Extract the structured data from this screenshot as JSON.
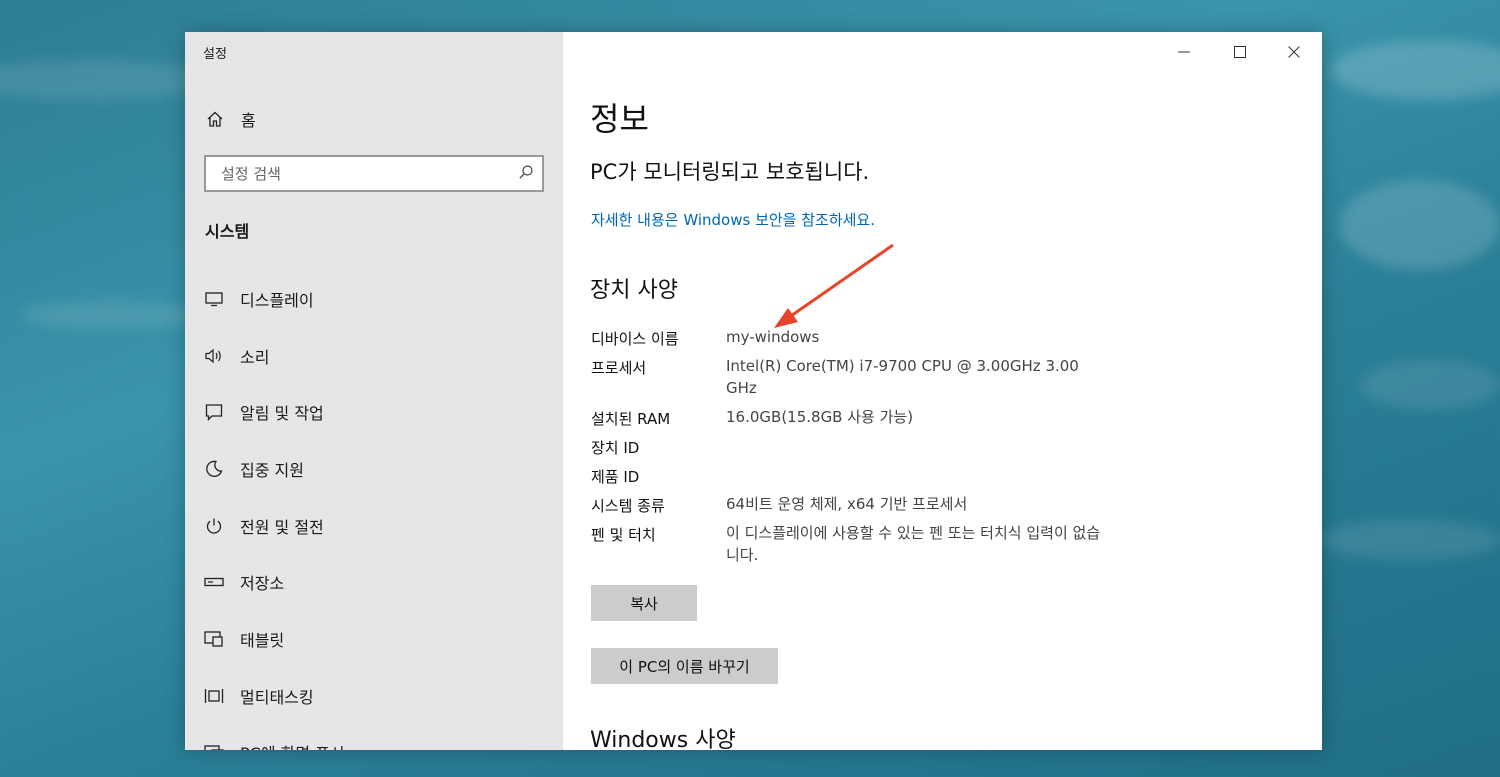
{
  "window": {
    "title": "설정",
    "controls": {
      "minimize": "—",
      "maximize": "☐",
      "close": "✕"
    }
  },
  "sidebar": {
    "home_label": "홈",
    "search_placeholder": "설정 검색",
    "section_heading": "시스템",
    "items": [
      {
        "label": "디스플레이",
        "icon": "monitor-icon"
      },
      {
        "label": "소리",
        "icon": "speaker-icon"
      },
      {
        "label": "알림 및 작업",
        "icon": "notification-icon"
      },
      {
        "label": "집중 지원",
        "icon": "moon-icon"
      },
      {
        "label": "전원 및 절전",
        "icon": "power-icon"
      },
      {
        "label": "저장소",
        "icon": "storage-icon"
      },
      {
        "label": "태블릿",
        "icon": "tablet-icon"
      },
      {
        "label": "멀티태스킹",
        "icon": "multitasking-icon"
      },
      {
        "label": "PC에 화면 표시",
        "icon": "project-icon"
      }
    ]
  },
  "main": {
    "title": "정보",
    "protection_status": "PC가 모니터링되고 보호됩니다.",
    "security_link": "자세한 내용은 Windows 보안을 참조하세요.",
    "device_specs": {
      "heading": "장치 사양",
      "rows": [
        {
          "label": "디바이스 이름",
          "value": "my-windows"
        },
        {
          "label": "프로세서",
          "value": "Intel(R) Core(TM) i7-9700 CPU @ 3.00GHz   3.00 GHz"
        },
        {
          "label": "설치된 RAM",
          "value": "16.0GB(15.8GB 사용 가능)"
        },
        {
          "label": "장치 ID",
          "value": ""
        },
        {
          "label": "제품 ID",
          "value": ""
        },
        {
          "label": "시스템 종류",
          "value": "64비트 운영 체제, x64 기반 프로세서"
        },
        {
          "label": "펜 및 터치",
          "value": "이 디스플레이에 사용할 수 있는 펜 또는 터치식 입력이 없습니다."
        }
      ]
    },
    "copy_button": "복사",
    "rename_button": "이 PC의 이름 바꾸기",
    "windows_specs_heading": "Windows 사양"
  },
  "colors": {
    "link": "#0067b8",
    "sidebar_bg": "#e6e6e6",
    "button_bg": "#cccccc",
    "annotation_arrow": "#e8442c"
  }
}
